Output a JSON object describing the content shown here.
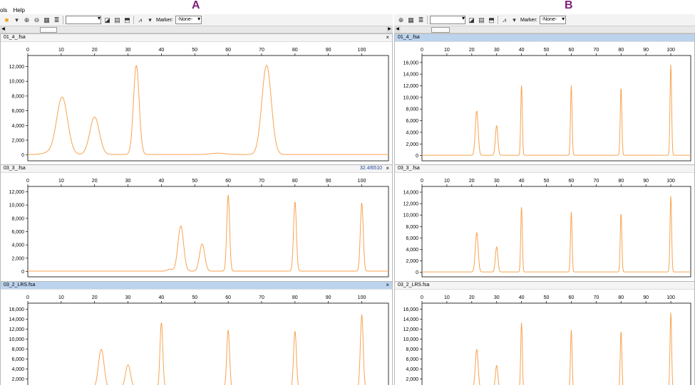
{
  "menu": [
    "ols",
    "Help"
  ],
  "toolbar": {
    "marker_label": "Marker:",
    "marker_value": "-None-"
  },
  "panels": [
    {
      "letter": "A"
    },
    {
      "letter": "B"
    }
  ],
  "colors": {
    "trace": "#f7a350",
    "selected_title": "#bcd3ee"
  },
  "chart_data": [
    {
      "type": "line",
      "panel": "A",
      "track": "01_4_.fsa",
      "xlim": [
        0,
        108
      ],
      "xticks": [
        0,
        10,
        20,
        30,
        40,
        50,
        60,
        70,
        80,
        90,
        100
      ],
      "ylim": [
        -800,
        13500
      ],
      "yticks": [
        0,
        2000,
        4000,
        6000,
        8000,
        10000,
        12000
      ],
      "peaks": [
        {
          "x": 10.3,
          "y": 7700,
          "w": 2.3
        },
        {
          "x": 20,
          "y": 5100,
          "w": 2.0
        },
        {
          "x": 32.5,
          "y": 12100,
          "w": 1.2
        },
        {
          "x": 71.5,
          "y": 12100,
          "w": 2.0
        },
        {
          "x": 57,
          "y": 180,
          "w": 3
        },
        {
          "x": 7,
          "y": 300,
          "w": 3
        }
      ]
    },
    {
      "type": "line",
      "panel": "A",
      "track": "03_3_.fsa",
      "readout": "32.4/6510",
      "xlim": [
        0,
        108
      ],
      "xticks": [
        0,
        10,
        20,
        30,
        40,
        50,
        60,
        70,
        80,
        90,
        100
      ],
      "ylim": [
        -800,
        12800
      ],
      "yticks": [
        0,
        2000,
        4000,
        6000,
        8000,
        10000,
        12000
      ],
      "peaks": [
        {
          "x": 45.8,
          "y": 6800,
          "w": 1.2
        },
        {
          "x": 52.2,
          "y": 4100,
          "w": 1.1
        },
        {
          "x": 60,
          "y": 11500,
          "w": 0.6
        },
        {
          "x": 80,
          "y": 10500,
          "w": 0.6
        },
        {
          "x": 100,
          "y": 10300,
          "w": 0.6
        },
        {
          "x": 42.5,
          "y": 300,
          "w": 1
        }
      ]
    },
    {
      "type": "line",
      "panel": "A",
      "track": "03_2_LRS.fsa",
      "xlim": [
        0,
        108
      ],
      "xticks": [
        0,
        10,
        20,
        30,
        40,
        50,
        60,
        70,
        80,
        90,
        100
      ],
      "ylim": [
        -900,
        17200
      ],
      "yticks": [
        0,
        2000,
        4000,
        6000,
        8000,
        10000,
        12000,
        14000,
        16000
      ],
      "peaks": [
        {
          "x": 22,
          "y": 7900,
          "w": 1.2
        },
        {
          "x": 30,
          "y": 4800,
          "w": 1.1
        },
        {
          "x": 40,
          "y": 13300,
          "w": 0.6
        },
        {
          "x": 60,
          "y": 11800,
          "w": 0.6
        },
        {
          "x": 80,
          "y": 11600,
          "w": 0.6
        },
        {
          "x": 100,
          "y": 14900,
          "w": 0.6
        }
      ]
    },
    {
      "type": "line",
      "panel": "B",
      "track": "01_4_.fsa",
      "xlim": [
        0,
        108
      ],
      "xticks": [
        0,
        10,
        20,
        30,
        40,
        50,
        60,
        70,
        80,
        90,
        100
      ],
      "ylim": [
        -900,
        17200
      ],
      "yticks": [
        0,
        2000,
        4000,
        6000,
        8000,
        10000,
        12000,
        14000,
        16000
      ],
      "peaks": [
        {
          "x": 22,
          "y": 7600,
          "w": 0.8
        },
        {
          "x": 30,
          "y": 5100,
          "w": 0.7
        },
        {
          "x": 40,
          "y": 12100,
          "w": 0.45
        },
        {
          "x": 60,
          "y": 12000,
          "w": 0.45
        },
        {
          "x": 80,
          "y": 11700,
          "w": 0.45
        },
        {
          "x": 100,
          "y": 15600,
          "w": 0.45
        }
      ]
    },
    {
      "type": "line",
      "panel": "B",
      "track": "03_3_.fsa",
      "xlim": [
        0,
        108
      ],
      "xticks": [
        0,
        10,
        20,
        30,
        40,
        50,
        60,
        70,
        80,
        90,
        100
      ],
      "ylim": [
        -800,
        15000
      ],
      "yticks": [
        0,
        2000,
        4000,
        6000,
        8000,
        10000,
        12000,
        14000
      ],
      "peaks": [
        {
          "x": 22,
          "y": 6900,
          "w": 0.8
        },
        {
          "x": 30,
          "y": 4400,
          "w": 0.7
        },
        {
          "x": 40,
          "y": 11400,
          "w": 0.45
        },
        {
          "x": 60,
          "y": 10500,
          "w": 0.45
        },
        {
          "x": 80,
          "y": 10300,
          "w": 0.45
        },
        {
          "x": 100,
          "y": 13300,
          "w": 0.45
        }
      ]
    },
    {
      "type": "line",
      "panel": "B",
      "track": "03_2_LRS.fsa",
      "xlim": [
        0,
        108
      ],
      "xticks": [
        0,
        10,
        20,
        30,
        40,
        50,
        60,
        70,
        80,
        90,
        100
      ],
      "ylim": [
        -900,
        17200
      ],
      "yticks": [
        0,
        2000,
        4000,
        6000,
        8000,
        10000,
        12000,
        14000,
        16000
      ],
      "peaks": [
        {
          "x": 22,
          "y": 7900,
          "w": 0.8
        },
        {
          "x": 30,
          "y": 4700,
          "w": 0.7
        },
        {
          "x": 40,
          "y": 13300,
          "w": 0.45
        },
        {
          "x": 60,
          "y": 11800,
          "w": 0.45
        },
        {
          "x": 80,
          "y": 11600,
          "w": 0.45
        },
        {
          "x": 100,
          "y": 15300,
          "w": 0.45
        }
      ]
    }
  ]
}
